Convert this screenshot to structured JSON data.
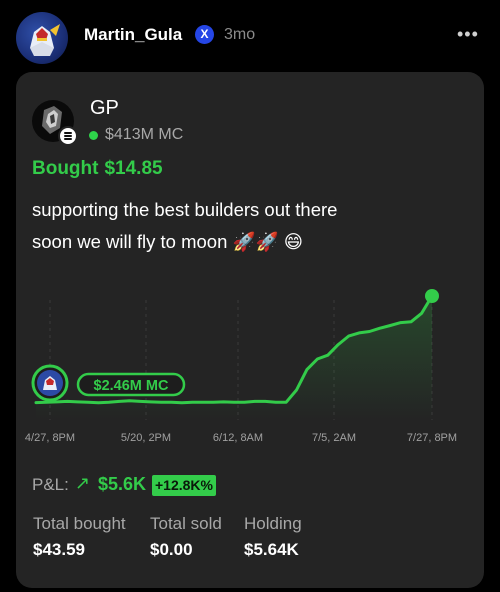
{
  "post": {
    "username": "Martin_Gula",
    "badge_glyph": "X",
    "time": "3mo",
    "more_label": "•••"
  },
  "token": {
    "symbol": "GP",
    "market_cap": "$413M MC"
  },
  "trade": {
    "bought_label": "Bought",
    "bought_amount": "$14.85",
    "note_line1": "supporting the best builders out there",
    "note_line2": "soon we will fly to moon 🚀🚀 😄"
  },
  "chart_data": {
    "type": "line",
    "x_labels": [
      "4/27, 8PM",
      "5/20, 2PM",
      "6/12, 8AM",
      "7/5, 2AM",
      "7/27, 8PM"
    ],
    "entry_label": "$2.46M MC",
    "values": [
      2.46,
      2.5,
      2.55,
      2.6,
      2.55,
      2.5,
      2.45,
      2.5,
      2.6,
      2.7,
      2.6,
      2.55,
      2.5,
      2.5,
      2.45,
      2.5,
      2.5,
      2.5,
      2.55,
      2.5,
      2.5,
      2.6,
      2.6,
      2.5,
      2.5,
      4.5,
      12,
      20,
      24,
      40,
      60,
      70,
      75,
      88,
      100,
      115,
      120,
      180,
      413
    ],
    "line_color": "#33cc4a"
  },
  "pnl": {
    "label": "P&L:",
    "arrow": "↗",
    "value": "$5.6K",
    "percent": "+12.8K%"
  },
  "stats": {
    "total_bought_label": "Total bought",
    "total_bought_value": "$43.59",
    "total_sold_label": "Total sold",
    "total_sold_value": "$0.00",
    "holding_label": "Holding",
    "holding_value": "$5.64K"
  }
}
